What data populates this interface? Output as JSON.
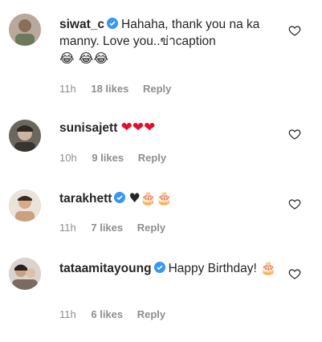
{
  "comments": [
    {
      "username": "siwat_c",
      "verified": true,
      "text": "Hahaha, thank you na ka manny. Love you..ข่าcaption",
      "emoji_line": "😂 😂😂",
      "time": "11h",
      "likes": "18 likes",
      "reply": "Reply"
    },
    {
      "username": "sunisajett",
      "verified": false,
      "text": "",
      "emoji_line": "❤❤❤",
      "time": "10h",
      "likes": "9 likes",
      "reply": "Reply"
    },
    {
      "username": "tarakhett",
      "verified": true,
      "text": "",
      "emoji_line": "♥🎂🎂",
      "time": "11h",
      "likes": "7 likes",
      "reply": "Reply"
    },
    {
      "username": "tataamitayoung",
      "verified": true,
      "text": "Happy Birthday!",
      "emoji_line": "🎂",
      "time": "11h",
      "likes": "6 likes",
      "reply": "Reply"
    }
  ],
  "colors": {
    "verified_blue": "#3897f0",
    "heart_red": "#e0102b",
    "meta_gray": "#8e8e8e"
  }
}
